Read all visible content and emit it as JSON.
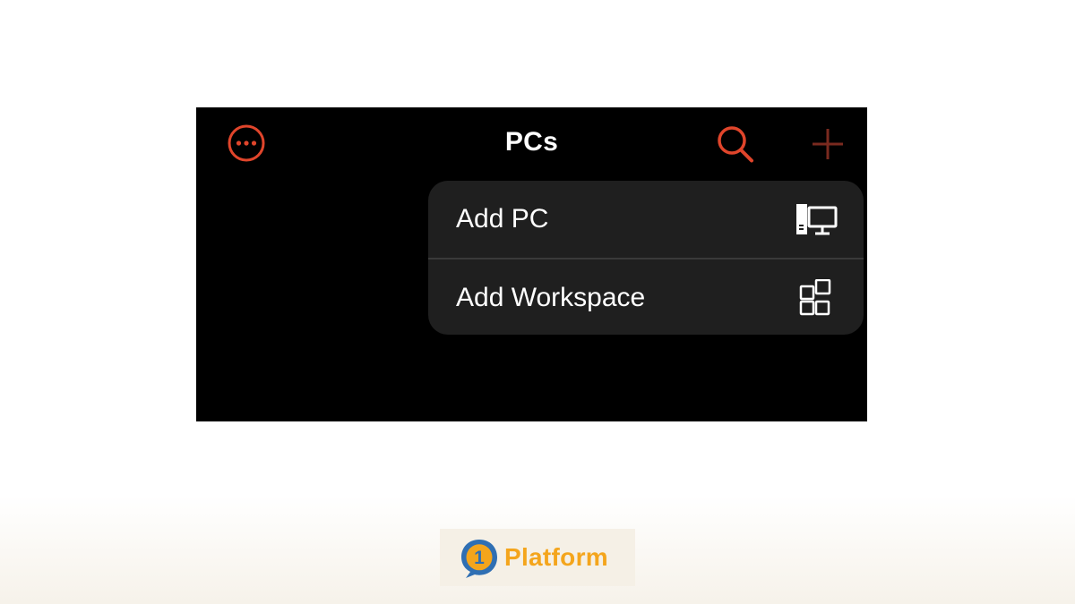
{
  "header": {
    "title": "PCs",
    "more_icon": "more-horizontal-icon",
    "search_icon": "search-icon",
    "add_icon": "plus-icon"
  },
  "menu": {
    "items": [
      {
        "label": "Add PC",
        "icon": "desktop-pc-icon"
      },
      {
        "label": "Add Workspace",
        "icon": "workspace-grid-icon"
      }
    ]
  },
  "logo": {
    "badge_text": "1",
    "text": "Platform"
  },
  "colors": {
    "accent": "#e0452b",
    "screen_bg": "#000000",
    "menu_bg": "#1f1f1f",
    "logo_orange": "#f4a51c",
    "logo_blue": "#2f6fb3"
  }
}
